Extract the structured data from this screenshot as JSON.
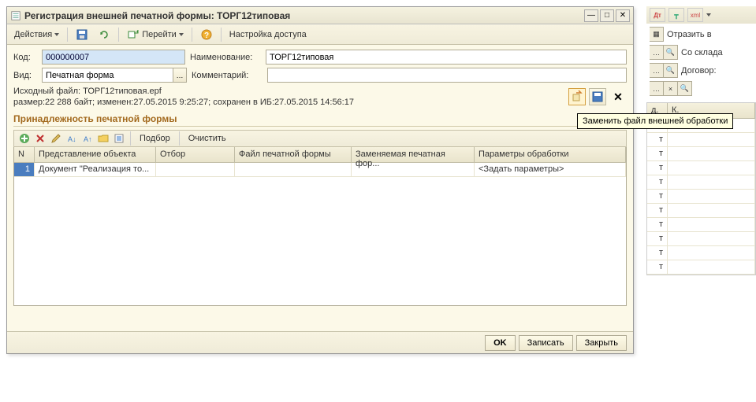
{
  "window": {
    "title": "Регистрация внешней печатной формы: ТОРГ12типовая"
  },
  "toolbar": {
    "actions": "Действия",
    "go": "Перейти",
    "access": "Настройка доступа"
  },
  "fields": {
    "code_label": "Код:",
    "code_value": "000000007",
    "name_label": "Наименование:",
    "name_value": "ТОРГ12типовая",
    "type_label": "Вид:",
    "type_value": "Печатная форма",
    "comment_label": "Комментарий:",
    "comment_value": ""
  },
  "source": {
    "line1": "Исходный файл: ТОРГ12типовая.epf",
    "line2": "размер:22 288 байт; изменен:27.05.2015 9:25:27; сохранен в ИБ:27.05.2015 14:56:17"
  },
  "section": {
    "membership_title": "Принадлежность печатной формы"
  },
  "grid_toolbar": {
    "select": "Подбор",
    "clear": "Очистить"
  },
  "columns": {
    "n": "N",
    "object": "Представление объекта",
    "filter": "Отбор",
    "file": "Файл печатной формы",
    "replaced": "Заменяемая печатная фор...",
    "params": "Параметры обработки"
  },
  "rows": [
    {
      "n": "1",
      "object": "Документ \"Реализация то...",
      "filter": "",
      "file": "",
      "replaced": "",
      "params": "<Задать параметры>"
    }
  ],
  "buttons": {
    "ok": "OK",
    "write": "Записать",
    "close": "Закрыть"
  },
  "tooltip": "Заменить файл внешней обработки",
  "background": {
    "reflect": "Отразить в",
    "from_warehouse": "Со склада",
    "contract": "Договор:",
    "col_d": "д.",
    "col_k": "К.",
    "row_char": "т"
  }
}
